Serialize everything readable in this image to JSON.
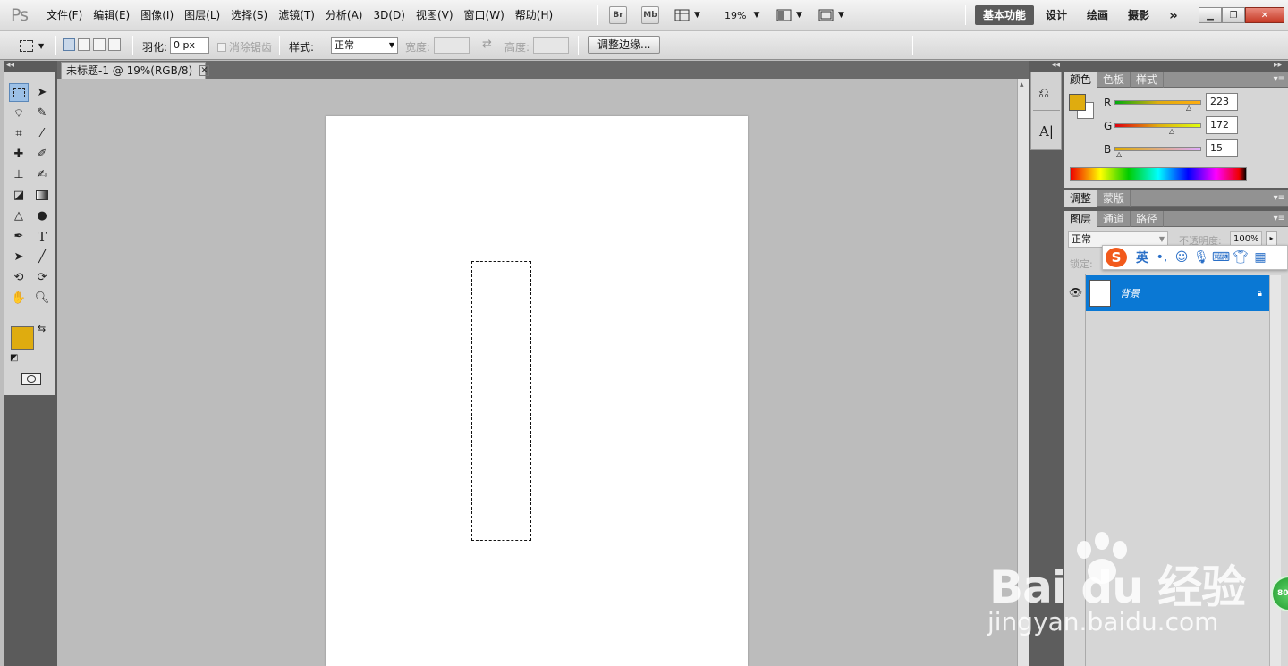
{
  "app": {
    "logo": "Ps"
  },
  "menubar": {
    "items": [
      "文件(F)",
      "编辑(E)",
      "图像(I)",
      "图层(L)",
      "选择(S)",
      "滤镜(T)",
      "分析(A)",
      "3D(D)",
      "视图(V)",
      "窗口(W)",
      "帮助(H)"
    ],
    "bridge_btn": "Br",
    "minibridge_btn": "Mb",
    "zoom": "19%",
    "workspaces": [
      "基本功能",
      "设计",
      "绘画",
      "摄影"
    ],
    "more": "»"
  },
  "options": {
    "feather_label": "羽化:",
    "feather_value": "0 px",
    "antialias_label": "消除锯齿",
    "style_label": "样式:",
    "style_value": "正常",
    "width_label": "宽度:",
    "height_label": "高度:",
    "refine_button": "调整边缘..."
  },
  "document": {
    "tab_title": "未标题-1 @ 19%(RGB/8)",
    "close": "×"
  },
  "colors": {
    "foreground": "#dfac0f",
    "background": "#ffffff",
    "selection_highlight": "#0a78d4"
  },
  "color_panel": {
    "tabs": [
      "颜色",
      "色板",
      "样式"
    ],
    "channels": [
      {
        "name": "R",
        "value": "223"
      },
      {
        "name": "G",
        "value": "172"
      },
      {
        "name": "B",
        "value": "15"
      }
    ]
  },
  "adjust_panel": {
    "tabs": [
      "调整",
      "蒙版"
    ]
  },
  "layers_panel": {
    "tabs": [
      "图层",
      "通道",
      "路径"
    ],
    "blend_mode": "正常",
    "opacity_label": "不透明度:",
    "opacity_value": "100%",
    "lock_label": "锁定:",
    "layers": [
      {
        "name": "背景",
        "visible": true,
        "locked": true,
        "selected": true
      }
    ]
  },
  "ime": {
    "mode": "英",
    "icons": [
      "punctuation-icon",
      "emoji-icon",
      "voice-icon",
      "keyboard-icon",
      "skin-icon",
      "toolbox-icon"
    ]
  },
  "watermark": {
    "brand": "Bai du 经验",
    "url": "jingyan.baidu.com",
    "badge": "80"
  }
}
